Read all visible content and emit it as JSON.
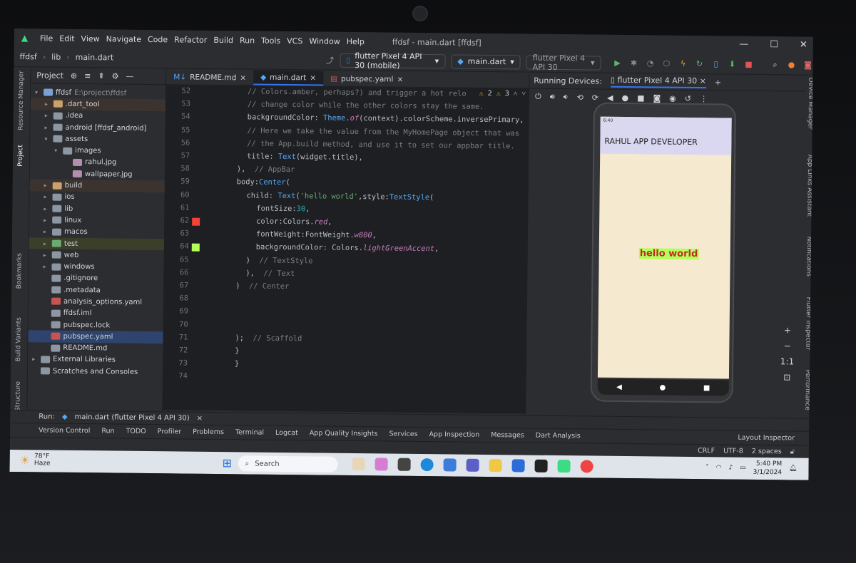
{
  "window": {
    "menu": [
      "File",
      "Edit",
      "View",
      "Navigate",
      "Code",
      "Refactor",
      "Build",
      "Run",
      "Tools",
      "VCS",
      "Window",
      "Help"
    ],
    "title": "ffdsf - main.dart [ffdsf]"
  },
  "toolbar": {
    "breadcrumbs": [
      "ffdsf",
      "lib",
      "main.dart"
    ],
    "device_selector": "flutter Pixel 4 API 30 (mobile)",
    "run_config": "main.dart",
    "emulator": "flutter Pixel 4 API 30"
  },
  "project": {
    "header": "Project",
    "items": [
      {
        "label": "ffdsf",
        "extra": "E:\\project\\ffdsf",
        "indent": 0,
        "arrow": "▾",
        "color": "#7aa0d8"
      },
      {
        "label": ".dart_tool",
        "indent": 1,
        "arrow": "▸",
        "color": "#c9a26b"
      },
      {
        "label": ".idea",
        "indent": 1,
        "arrow": "▸",
        "color": "#8d96a3"
      },
      {
        "label": "android [ffdsf_android]",
        "indent": 1,
        "arrow": "▸",
        "color": "#8d96a3"
      },
      {
        "label": "assets",
        "indent": 1,
        "arrow": "▾",
        "color": "#8d96a3"
      },
      {
        "label": "images",
        "indent": 2,
        "arrow": "▾",
        "color": "#8d96a3"
      },
      {
        "label": "rahul.jpg",
        "indent": 3,
        "arrow": "",
        "color": "#b48ead"
      },
      {
        "label": "wallpaper.jpg",
        "indent": 3,
        "arrow": "",
        "color": "#b48ead"
      },
      {
        "label": "build",
        "indent": 1,
        "arrow": "▸",
        "color": "#c9a26b"
      },
      {
        "label": "ios",
        "indent": 1,
        "arrow": "▸",
        "color": "#8d96a3"
      },
      {
        "label": "lib",
        "indent": 1,
        "arrow": "▸",
        "color": "#8d96a3"
      },
      {
        "label": "linux",
        "indent": 1,
        "arrow": "▸",
        "color": "#8d96a3"
      },
      {
        "label": "macos",
        "indent": 1,
        "arrow": "▸",
        "color": "#8d96a3"
      },
      {
        "label": "test",
        "indent": 1,
        "arrow": "▸",
        "color": "#6aab73"
      },
      {
        "label": "web",
        "indent": 1,
        "arrow": "▸",
        "color": "#8d96a3"
      },
      {
        "label": "windows",
        "indent": 1,
        "arrow": "▸",
        "color": "#8d96a3"
      },
      {
        "label": ".gitignore",
        "indent": 1,
        "arrow": "",
        "color": "#8d96a3"
      },
      {
        "label": ".metadata",
        "indent": 1,
        "arrow": "",
        "color": "#8d96a3"
      },
      {
        "label": "analysis_options.yaml",
        "indent": 1,
        "arrow": "",
        "color": "#c75450"
      },
      {
        "label": "ffdsf.iml",
        "indent": 1,
        "arrow": "",
        "color": "#8d96a3"
      },
      {
        "label": "pubspec.lock",
        "indent": 1,
        "arrow": "",
        "color": "#8d96a3"
      },
      {
        "label": "pubspec.yaml",
        "indent": 1,
        "arrow": "",
        "color": "#c75450"
      },
      {
        "label": "README.md",
        "indent": 1,
        "arrow": "",
        "color": "#8d96a3"
      },
      {
        "label": "External Libraries",
        "indent": 0,
        "arrow": "▸",
        "color": "#8d96a3"
      },
      {
        "label": "Scratches and Consoles",
        "indent": 0,
        "arrow": "",
        "color": "#8d96a3"
      }
    ]
  },
  "left_tools": [
    "Resource Manager",
    "Project",
    "Bookmarks",
    "Build Variants",
    "Structure"
  ],
  "right_tools": [
    "Device Manager",
    "App Links Assistant",
    "Notifications",
    "Flutter Inspector",
    "Flutter Performance"
  ],
  "editor": {
    "tabs": [
      "README.md",
      "main.dart",
      "pubspec.yaml"
    ],
    "inspections": {
      "warnings": "2",
      "weak": "3"
    },
    "lines": [
      {
        "n": "52",
        "segs": [
          [
            "cm",
            "// Colors.amber, perhaps?) and trigger a hot relo"
          ]
        ],
        "indent": 1
      },
      {
        "n": "53",
        "segs": [
          [
            "cm",
            "// change color while the other colors stay the same."
          ]
        ],
        "indent": 1
      },
      {
        "n": "54",
        "segs": [
          [
            "pu",
            "backgroundColor: "
          ],
          [
            "fn",
            "Theme"
          ],
          [
            "pu",
            "."
          ],
          [
            "it",
            "of"
          ],
          [
            "pu",
            "(context).colorScheme.inversePrimary,"
          ]
        ],
        "indent": 1
      },
      {
        "n": "55",
        "segs": [
          [
            "cm",
            "// Here we take the value from the MyHomePage object that was"
          ]
        ],
        "indent": 1
      },
      {
        "n": "56",
        "segs": [
          [
            "cm",
            "// the App.build method, and use it to set our appbar title."
          ]
        ],
        "indent": 1
      },
      {
        "n": "57",
        "segs": [
          [
            "pu",
            "title: "
          ],
          [
            "fn",
            "Text"
          ],
          [
            "pu",
            "(widget.title),"
          ]
        ],
        "indent": 1
      },
      {
        "n": "58",
        "segs": [
          [
            "pu",
            "),  "
          ],
          [
            "cm",
            "// AppBar"
          ]
        ],
        "indent": 0
      },
      {
        "n": "59",
        "segs": [
          [
            "pu",
            "body:"
          ],
          [
            "fn",
            "Center"
          ],
          [
            "pu",
            "("
          ]
        ],
        "indent": 0
      },
      {
        "n": "60",
        "segs": [
          [
            "pu",
            "child: "
          ],
          [
            "fn",
            "Text"
          ],
          [
            "pu",
            "("
          ],
          [
            "st",
            "'hello world'"
          ],
          [
            "pu",
            ",style:"
          ],
          [
            "fn",
            "TextStyle"
          ],
          [
            "pu",
            "("
          ]
        ],
        "indent": 1
      },
      {
        "n": "61",
        "segs": [
          [
            "pu",
            "fontSize:"
          ],
          [
            "nm",
            "30"
          ],
          [
            "pu",
            ","
          ]
        ],
        "indent": 2
      },
      {
        "n": "62",
        "segs": [
          [
            "pu",
            "color:Colors."
          ],
          [
            "it",
            "red"
          ],
          [
            "pu",
            ","
          ]
        ],
        "indent": 2
      },
      {
        "n": "63",
        "segs": [
          [
            "pu",
            "fontWeight:FontWeight."
          ],
          [
            "it",
            "w800"
          ],
          [
            "pu",
            ","
          ]
        ],
        "indent": 2
      },
      {
        "n": "64",
        "segs": [
          [
            "pu",
            "backgroundColor: Colors."
          ],
          [
            "it",
            "lightGreenAccent"
          ],
          [
            "pu",
            ","
          ]
        ],
        "indent": 2
      },
      {
        "n": "65",
        "segs": [
          [
            "pu",
            ")  "
          ],
          [
            "cm",
            "// TextStyle"
          ]
        ],
        "indent": 1
      },
      {
        "n": "66",
        "segs": [
          [
            "pu",
            "),  "
          ],
          [
            "cm",
            "// Text"
          ]
        ],
        "indent": 1
      },
      {
        "n": "67",
        "segs": [
          [
            "pu",
            ")  "
          ],
          [
            "cm",
            "// Center"
          ]
        ],
        "indent": 0
      },
      {
        "n": "68",
        "segs": [],
        "indent": 0
      },
      {
        "n": "69",
        "segs": [],
        "indent": 0
      },
      {
        "n": "70",
        "segs": [],
        "indent": 0
      },
      {
        "n": "71",
        "segs": [
          [
            "pu",
            ");  "
          ],
          [
            "cm",
            "// Scaffold"
          ]
        ],
        "indent": 0
      },
      {
        "n": "72",
        "segs": [
          [
            "pu",
            "}"
          ]
        ],
        "indent": 0
      },
      {
        "n": "73",
        "segs": [
          [
            "pu",
            "}"
          ]
        ],
        "indent": 0
      },
      {
        "n": "74",
        "segs": [],
        "indent": 0
      }
    ]
  },
  "running_devices": {
    "label": "Running Devices:",
    "tab": "flutter Pixel 4 API 30",
    "status_time": "6:40",
    "appbar_title": "RAHUL APP DEVELOPER",
    "body_text": "hello world"
  },
  "run_bar": {
    "label": "Run:",
    "config": "main.dart (flutter Pixel 4 API 30)"
  },
  "tool_windows": [
    "Version Control",
    "Run",
    "TODO",
    "Profiler",
    "Problems",
    "Terminal",
    "Logcat",
    "App Quality Insights",
    "Services",
    "App Inspection",
    "Messages",
    "Dart Analysis",
    "Layout Inspector"
  ],
  "status": {
    "line_sep": "CRLF",
    "encoding": "UTF-8",
    "indent": "2 spaces"
  },
  "taskbar": {
    "temp": "78°F",
    "weather": "Haze",
    "search": "Search",
    "time": "5:40 PM",
    "date": "3/1/2024"
  }
}
